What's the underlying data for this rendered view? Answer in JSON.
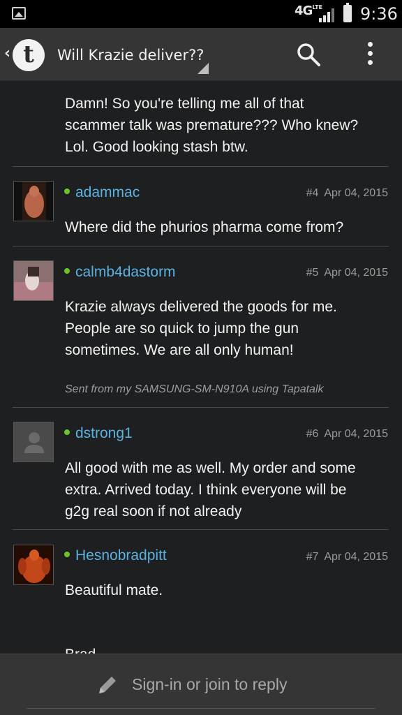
{
  "status_bar": {
    "network": "4G",
    "network_sub": "LTE",
    "time": "9:36",
    "icons": [
      "gallery-icon",
      "signal-icon",
      "battery-icon"
    ]
  },
  "app_bar": {
    "back_glyph": "‹",
    "logo_letter": "t",
    "title": "Will Krazie deliver??",
    "icons": [
      "search-icon",
      "overflow-menu-icon"
    ]
  },
  "posts": [
    {
      "body": [
        "Damn! So you're telling me all of that",
        "scammer talk was premature??? Who knew?",
        "Lol. Good looking stash btw."
      ]
    },
    {
      "author": "adammac",
      "number": "#4",
      "date": "Apr 04, 2015",
      "body": [
        "Where did the phurios pharma come from?"
      ]
    },
    {
      "author": "calmb4dastorm",
      "number": "#5",
      "date": "Apr 04, 2015",
      "body": [
        "Krazie always delivered the goods for me.",
        "People are so quick to jump the gun",
        "sometimes. We are all only human!"
      ],
      "signature": "Sent from my SAMSUNG-SM-N910A using Tapatalk"
    },
    {
      "author": "dstrong1",
      "number": "#6",
      "date": "Apr 04, 2015",
      "body": [
        "All good with me as well. My order and some",
        "extra. Arrived today. I think everyone will be",
        "g2g real soon if not already"
      ]
    },
    {
      "author": "Hesnobradpitt",
      "number": "#7",
      "date": "Apr 04, 2015",
      "body": [
        "Beautiful mate.",
        "Brad"
      ]
    }
  ],
  "reply_bar": {
    "label": "Sign-in or join to reply",
    "icon": "pencil-icon"
  },
  "colors": {
    "background": "#1e1f20",
    "bar": "#353535",
    "author_link": "#5bb2e0",
    "online": "#6ec42c"
  }
}
